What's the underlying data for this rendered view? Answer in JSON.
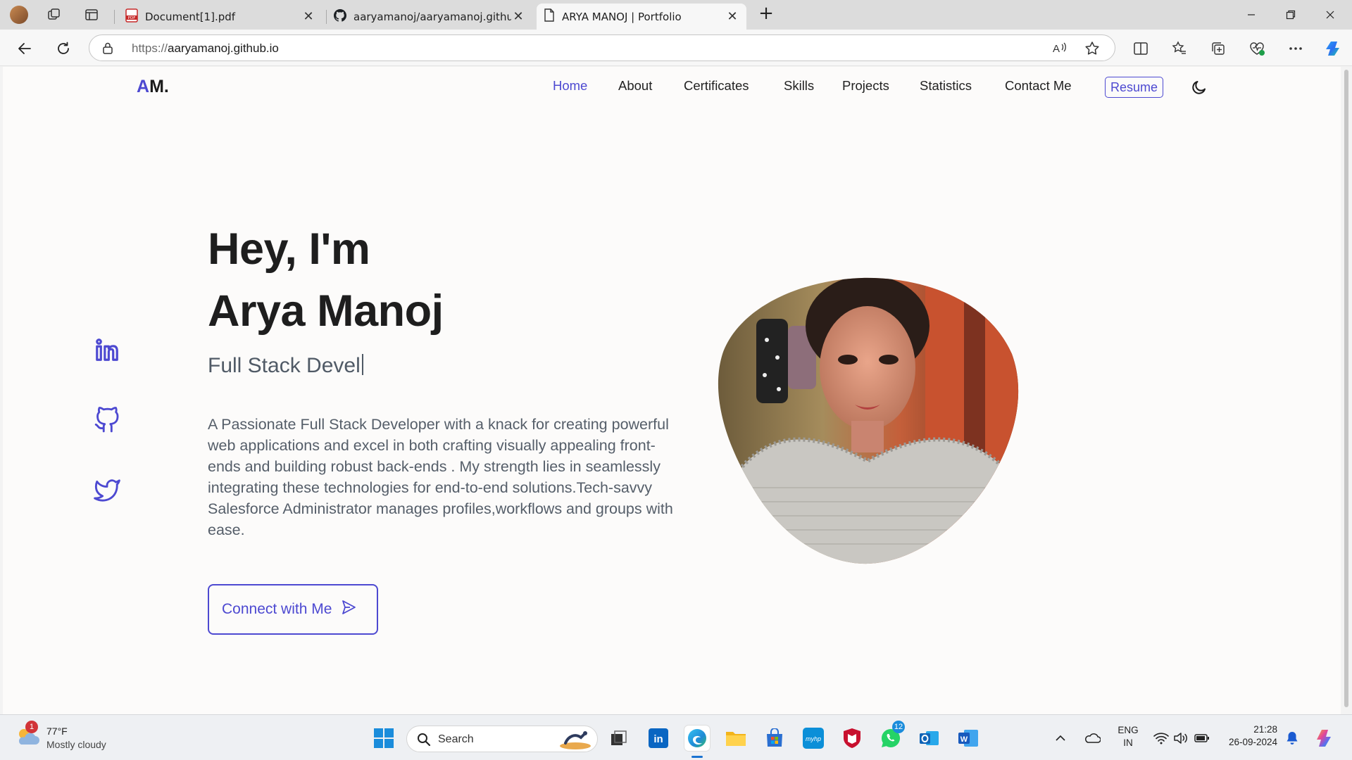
{
  "browser": {
    "tabs": [
      {
        "title": "Document[1].pdf",
        "icon": "pdf-icon",
        "close": "✕"
      },
      {
        "title": "aaryamanoj/aaryamanoj.github.io",
        "icon": "github-icon",
        "close": "✕"
      },
      {
        "title": "ARYA MANOJ | Portfolio",
        "icon": "page-icon",
        "close": "✕",
        "active": true
      }
    ],
    "new_tab": "+",
    "url_protocol": "https://",
    "url_host": "aaryamanoj.github.io"
  },
  "site": {
    "logo_accent": "A",
    "logo_rest": "M.",
    "nav": {
      "home": "Home",
      "about": "About",
      "certificates": "Certificates",
      "skills": "Skills",
      "projects": "Projects",
      "statistics": "Statistics",
      "contact": "Contact Me"
    },
    "resume": "Resume",
    "hero": {
      "greeting_line1": "Hey, I'm",
      "greeting_line2": "Arya Manoj",
      "role_typed": "Full Stack Devel",
      "bio": "A Passionate Full Stack Developer with a knack for creating powerful web applications and excel in both crafting visually appealing front-ends and building robust back-ends . My strength lies in seamlessly integrating these technologies for end-to-end solutions.Tech-savvy Salesforce Administrator manages profiles,workflows and groups with ease.",
      "cta": "Connect with Me"
    },
    "socials": [
      "linkedin-icon",
      "github-icon",
      "twitter-icon"
    ],
    "accent_color": "#4d49d1"
  },
  "taskbar": {
    "weather": {
      "temp": "77°F",
      "condition": "Mostly cloudy",
      "badge": "1"
    },
    "search_label": "Search",
    "whatsapp_badge": "12",
    "lang_line1": "ENG",
    "lang_line2": "IN",
    "time": "21:28",
    "date": "26-09-2024"
  }
}
